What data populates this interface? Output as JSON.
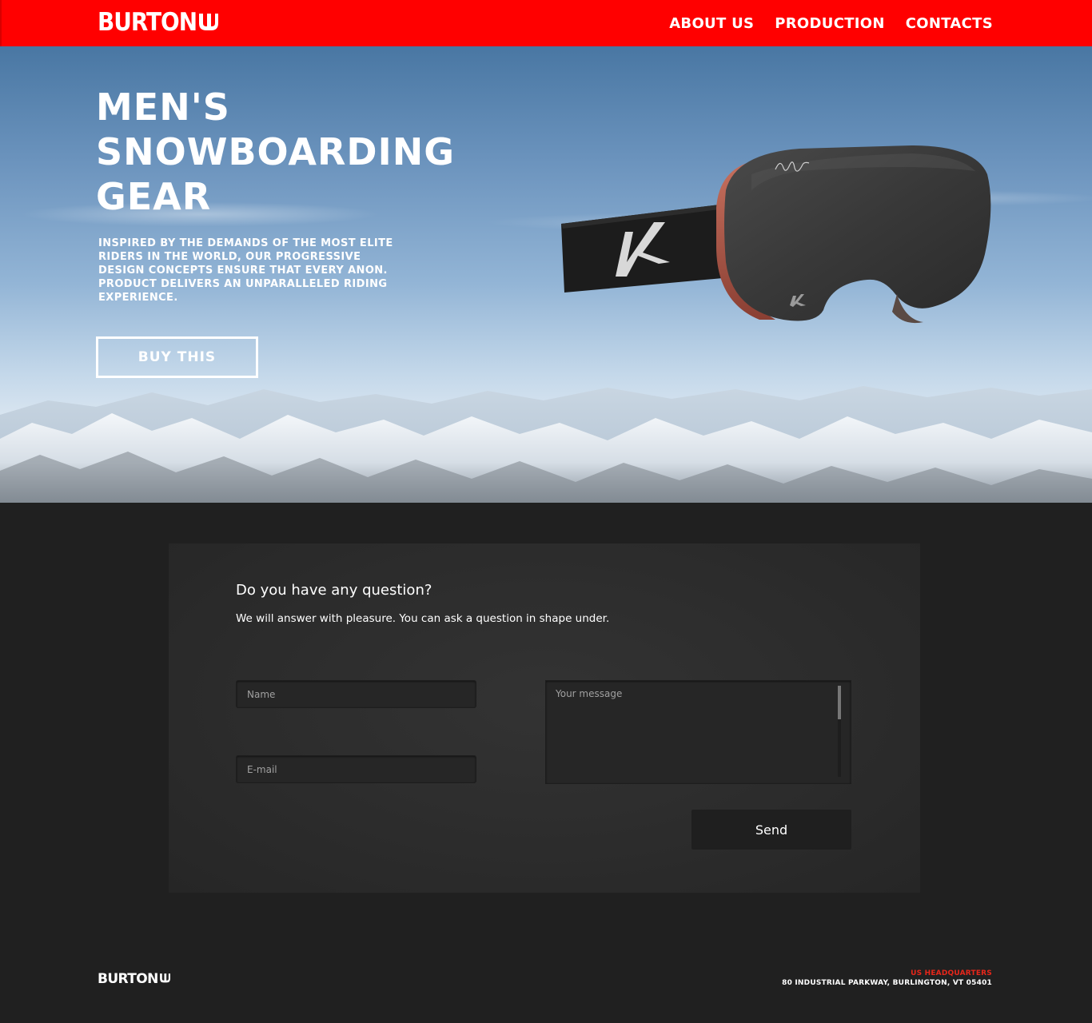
{
  "header": {
    "logo": "BURTON",
    "nav": [
      {
        "label": "ABOUT US"
      },
      {
        "label": "PRODUCTION"
      },
      {
        "label": "CONTACTS"
      }
    ]
  },
  "hero": {
    "title_lines": [
      "MEN'S",
      "SNOWBOARDING",
      "GEAR"
    ],
    "description": "INSPIRED BY THE DEMANDS OF THE MOST ELITE RIDERS IN THE WORLD, OUR PROGRESSIVE DESIGN CONCEPTS ENSURE THAT EVERY ANON. PRODUCT DELIVERS AN UNPARALLELED RIDING EXPERIENCE.",
    "cta_label": "BUY THIS"
  },
  "contact": {
    "title": "Do you have any question?",
    "subtitle": "We will answer with pleasure. You can ask a question in shape under.",
    "name_placeholder": "Name",
    "email_placeholder": "E-mail",
    "message_placeholder": "Your message",
    "send_label": "Send"
  },
  "footer": {
    "logo": "BURTON",
    "hq_label": "US HEADQUARTERS",
    "hq_address": "80 INDUSTRIAL PARKWAY, BURLINGTON, VT 05401"
  },
  "colors": {
    "brand_red": "#ff0000",
    "dark_bg": "#202020",
    "panel_bg": "#2c2c2c",
    "hq_red": "#e8261a"
  },
  "icons": [
    "burton-logo-mark-icon",
    "anon-logo-icon"
  ]
}
